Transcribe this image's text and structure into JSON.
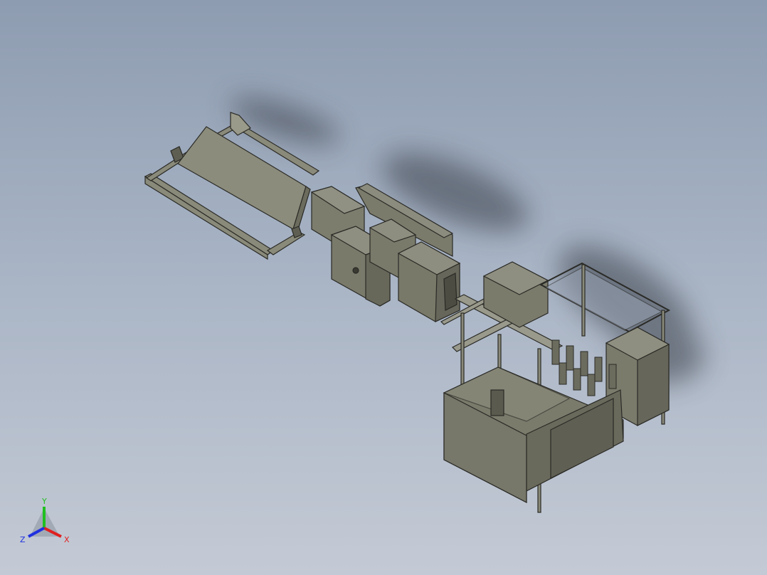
{
  "viewport": {
    "background_top": "#8e9cb1",
    "background_bottom": "#c4cad5",
    "part_color": "#7b7b6c",
    "edge_color": "#2a2a26"
  },
  "triad": {
    "x_label": "X",
    "y_label": "Y",
    "z_label": "Z",
    "x_color": "#e02020",
    "y_color": "#20c020",
    "z_color": "#2030e0"
  }
}
